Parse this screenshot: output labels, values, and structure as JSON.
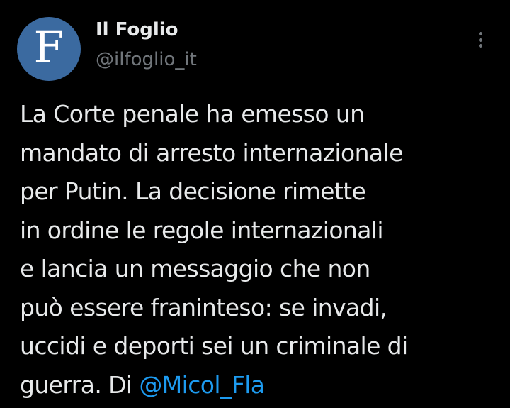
{
  "author": {
    "display_name": "Il Foglio",
    "handle": "@ilfoglio_it",
    "avatar_letter": "F",
    "avatar_color": "#3b6aa0"
  },
  "more_icon": "more-vertical-icon",
  "tweet": {
    "lines": [
      "La Corte penale ha emesso un",
      "mandato di arresto internazionale",
      "per Putin. La decisione rimette",
      "in ordine le regole internazionali",
      "e lancia un messaggio che non",
      "può essere franinteso: se invadi,",
      "uccidi e deporti sei un criminale di"
    ],
    "last_line_text": "guerra. Di ",
    "mention": "@Micol_Fla"
  },
  "colors": {
    "background": "#000000",
    "text": "#e7e9ea",
    "secondary": "#71767b",
    "link": "#1d9bf0"
  }
}
